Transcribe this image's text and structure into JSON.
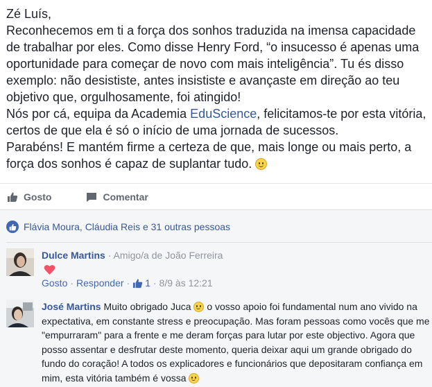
{
  "post": {
    "greeting": "Zé Luís,",
    "line1": "Reconhecemos em ti a força dos sonhos traduzida na imensa capacidade de trabalhar por eles. Como disse Henry Ford, “o insucesso é apenas uma oportunidade para começar de novo com mais inteligência”. Tu és disso exemplo: não desististe, antes insististe e avançaste em direção ao teu objetivo que, orgulhosamente, foi atingido!",
    "line2_before": "Nós por cá, equipa da Academia ",
    "line2_link": "EduScience",
    "line2_after": ", felicitamos-te por esta vitória, certos de que ela é só o início de uma jornada de sucessos.",
    "line3": "Parabéns! E mantém firme a certeza de que, mais longe ou mais perto, a força dos sonhos é capaz de suplantar tudo."
  },
  "actions": {
    "like_label": "Gosto",
    "comment_label": "Comentar"
  },
  "reactions": {
    "summary": "Flávia Moura, Cláudia Reis e 31 outras pessoas"
  },
  "comments": [
    {
      "author": "Dulce Martins",
      "relation": "· Amigo/a de João Ferreira",
      "like_label": "Gosto",
      "reply_label": "Responder",
      "like_count": "1",
      "timestamp": "· 8/9 às 12:21"
    },
    {
      "author": "José Martins",
      "text_a": "Muito obrigado Juca",
      "text_b": "o vosso apoio foi fundamental num ano vivido na expectativa, em constante stress e preocupação. Mas foram pessoas como vocês que me \"empurraram\" para a frente e me deram forças para lutar por este objectivo. Agora que posso assentar e desfrutar deste momento, queria deixar aqui um grande obrigado do fundo do coração! A todos os explicadores e funcionários que depositaram confiança em mim, esta vitória também é vossa"
    }
  ],
  "colors": {
    "link": "#365899",
    "accent": "#4267b2",
    "heart": "#f25268"
  }
}
